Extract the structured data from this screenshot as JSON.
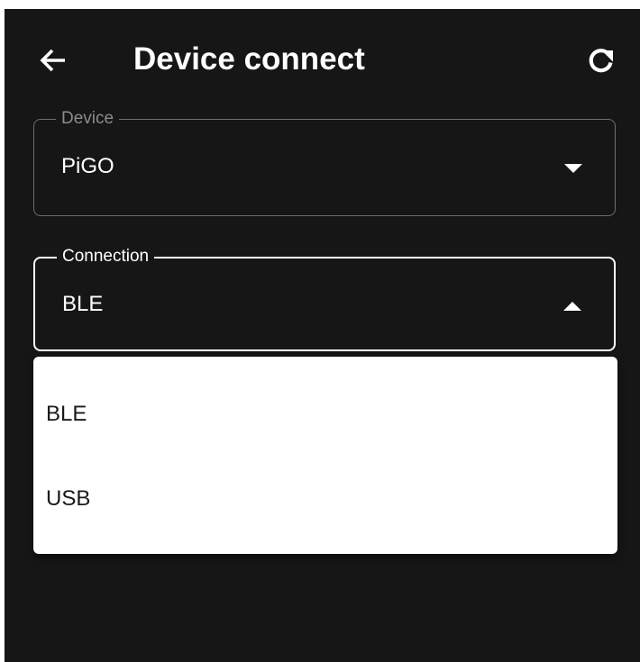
{
  "colors": {
    "background": "#161616",
    "text_primary": "#ffffff",
    "outline_inactive": "#6e6e6e",
    "outline_active": "#ffffff",
    "menu_background": "#ffffff",
    "menu_text": "#1a1a1a"
  },
  "appbar": {
    "title": "Device connect",
    "back_icon": "arrow-left-icon",
    "refresh_icon": "refresh-icon"
  },
  "device_field": {
    "label": "Device",
    "value": "PiGO",
    "icon": "caret-down-icon"
  },
  "connection_field": {
    "label": "Connection",
    "value": "BLE",
    "icon": "caret-up-icon",
    "expanded": true
  },
  "connection_menu": {
    "options": [
      {
        "label": "BLE"
      },
      {
        "label": "USB"
      }
    ]
  }
}
